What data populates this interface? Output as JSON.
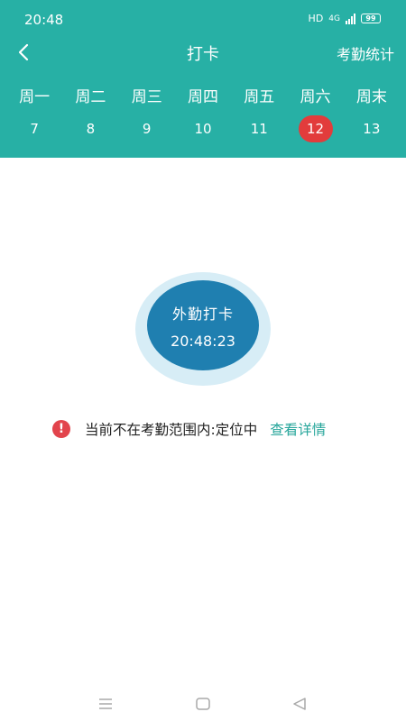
{
  "status_bar": {
    "time": "20:48",
    "hd": "HD",
    "network": "4G",
    "battery": "99"
  },
  "title_bar": {
    "back_icon": "chevron-left-icon",
    "title": "打卡",
    "stats_label": "考勤统计"
  },
  "week": {
    "days": [
      {
        "weekday": "周一",
        "date": "7"
      },
      {
        "weekday": "周二",
        "date": "8"
      },
      {
        "weekday": "周三",
        "date": "9"
      },
      {
        "weekday": "周四",
        "date": "10"
      },
      {
        "weekday": "周五",
        "date": "11"
      },
      {
        "weekday": "周六",
        "date": "12",
        "selected": true
      },
      {
        "weekday": "周末",
        "date": "13"
      }
    ]
  },
  "punch": {
    "label": "外勤打卡",
    "time": "20:48:23"
  },
  "alert": {
    "icon": "exclamation-icon",
    "message": "当前不在考勤范围内:定位中",
    "link": "查看详情"
  },
  "colors": {
    "header": "#27b0a5",
    "selected_date": "#e23c3c",
    "punch_button": "#1f7fb0",
    "punch_halo": "#d7edf6",
    "alert_icon": "#e2444c",
    "link": "#27a69b"
  },
  "nav_bar": {
    "icons": [
      "menu-icon",
      "home-icon",
      "back-triangle-icon"
    ]
  }
}
